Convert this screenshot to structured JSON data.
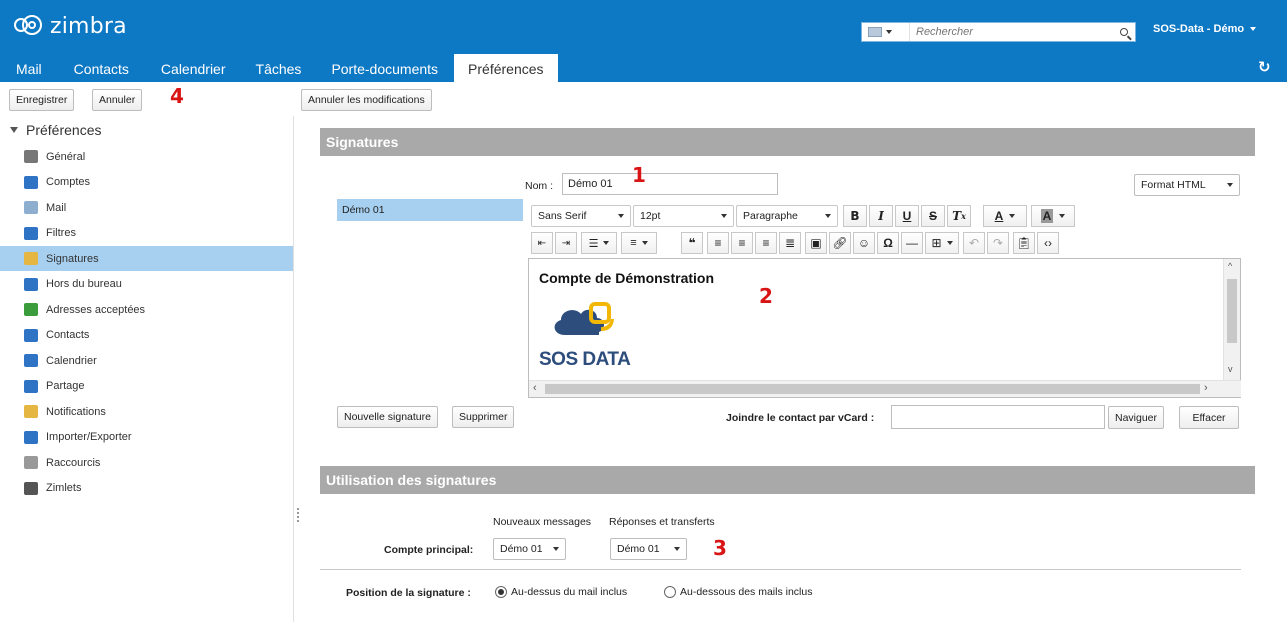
{
  "app": {
    "logo_text": "zimbra"
  },
  "search": {
    "placeholder": "Rechercher"
  },
  "user": {
    "name": "SOS-Data - Démo"
  },
  "tabs": [
    {
      "label": "Mail"
    },
    {
      "label": "Contacts"
    },
    {
      "label": "Calendrier"
    },
    {
      "label": "Tâches"
    },
    {
      "label": "Porte-documents"
    },
    {
      "label": "Préférences"
    }
  ],
  "toolbar": {
    "save": "Enregistrer",
    "cancel": "Annuler",
    "undo_changes": "Annuler les modifications"
  },
  "annotations": {
    "one": "1",
    "two": "2",
    "three": "3",
    "four": "4"
  },
  "sidebar": {
    "title": "Préférences",
    "items": [
      {
        "label": "Général",
        "icon": "gear-icon",
        "color": "#777777"
      },
      {
        "label": "Comptes",
        "icon": "accounts-icon",
        "color": "#2f73c4"
      },
      {
        "label": "Mail",
        "icon": "mail-icon",
        "color": "#8eaed0"
      },
      {
        "label": "Filtres",
        "icon": "filter-icon",
        "color": "#2f73c4"
      },
      {
        "label": "Signatures",
        "icon": "signature-icon",
        "color": "#e5b642"
      },
      {
        "label": "Hors du bureau",
        "icon": "out-of-office-icon",
        "color": "#2f73c4"
      },
      {
        "label": "Adresses acceptées",
        "icon": "shield-icon",
        "color": "#3b9c3b"
      },
      {
        "label": "Contacts",
        "icon": "contact-icon",
        "color": "#2f73c4"
      },
      {
        "label": "Calendrier",
        "icon": "calendar-icon",
        "color": "#2f73c4"
      },
      {
        "label": "Partage",
        "icon": "share-icon",
        "color": "#2f73c4"
      },
      {
        "label": "Notifications",
        "icon": "bell-icon",
        "color": "#e5b642"
      },
      {
        "label": "Importer/Exporter",
        "icon": "import-export-icon",
        "color": "#2f73c4"
      },
      {
        "label": "Raccourcis",
        "icon": "keyboard-icon",
        "color": "#999999"
      },
      {
        "label": "Zimlets",
        "icon": "zimlet-icon",
        "color": "#555555"
      }
    ],
    "selected_index": 4
  },
  "signatures": {
    "section_title": "Signatures",
    "name_label": "Nom :",
    "name_value": "Démo 01",
    "format": "Format HTML",
    "list": [
      "Démo 01"
    ],
    "font": "Sans Serif",
    "size": "12pt",
    "block": "Paragraphe",
    "editor_heading": "Compte de Démonstration",
    "logo_text": "SOS DATA",
    "new_button": "Nouvelle signature",
    "delete_button": "Supprimer",
    "vcard_label": "Joindre le contact par vCard :",
    "vcard_value": "",
    "browse_button": "Naviguer",
    "clear_button": "Effacer"
  },
  "usage": {
    "section_title": "Utilisation des signatures",
    "col_new": "Nouveaux messages",
    "col_reply": "Réponses et transferts",
    "account_label": "Compte principal:",
    "new_value": "Démo 01",
    "reply_value": "Démo 01",
    "position_label": "Position de la signature :",
    "position_above": "Au-dessus du mail inclus",
    "position_below": "Au-dessous des mails inclus",
    "position_selected": "above"
  }
}
